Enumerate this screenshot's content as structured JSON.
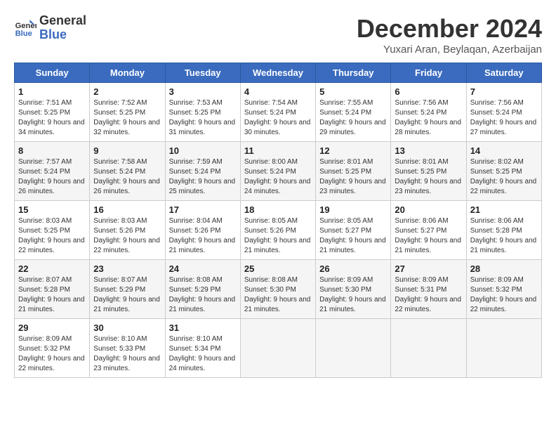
{
  "logo": {
    "line1": "General",
    "line2": "Blue"
  },
  "title": "December 2024",
  "subtitle": "Yuxari Aran, Beylaqan, Azerbaijan",
  "days_of_week": [
    "Sunday",
    "Monday",
    "Tuesday",
    "Wednesday",
    "Thursday",
    "Friday",
    "Saturday"
  ],
  "weeks": [
    [
      {
        "day": "1",
        "sunrise": "7:51 AM",
        "sunset": "5:25 PM",
        "daylight": "9 hours and 34 minutes."
      },
      {
        "day": "2",
        "sunrise": "7:52 AM",
        "sunset": "5:25 PM",
        "daylight": "9 hours and 32 minutes."
      },
      {
        "day": "3",
        "sunrise": "7:53 AM",
        "sunset": "5:25 PM",
        "daylight": "9 hours and 31 minutes."
      },
      {
        "day": "4",
        "sunrise": "7:54 AM",
        "sunset": "5:24 PM",
        "daylight": "9 hours and 30 minutes."
      },
      {
        "day": "5",
        "sunrise": "7:55 AM",
        "sunset": "5:24 PM",
        "daylight": "9 hours and 29 minutes."
      },
      {
        "day": "6",
        "sunrise": "7:56 AM",
        "sunset": "5:24 PM",
        "daylight": "9 hours and 28 minutes."
      },
      {
        "day": "7",
        "sunrise": "7:56 AM",
        "sunset": "5:24 PM",
        "daylight": "9 hours and 27 minutes."
      }
    ],
    [
      {
        "day": "8",
        "sunrise": "7:57 AM",
        "sunset": "5:24 PM",
        "daylight": "9 hours and 26 minutes."
      },
      {
        "day": "9",
        "sunrise": "7:58 AM",
        "sunset": "5:24 PM",
        "daylight": "9 hours and 26 minutes."
      },
      {
        "day": "10",
        "sunrise": "7:59 AM",
        "sunset": "5:24 PM",
        "daylight": "9 hours and 25 minutes."
      },
      {
        "day": "11",
        "sunrise": "8:00 AM",
        "sunset": "5:24 PM",
        "daylight": "9 hours and 24 minutes."
      },
      {
        "day": "12",
        "sunrise": "8:01 AM",
        "sunset": "5:25 PM",
        "daylight": "9 hours and 23 minutes."
      },
      {
        "day": "13",
        "sunrise": "8:01 AM",
        "sunset": "5:25 PM",
        "daylight": "9 hours and 23 minutes."
      },
      {
        "day": "14",
        "sunrise": "8:02 AM",
        "sunset": "5:25 PM",
        "daylight": "9 hours and 22 minutes."
      }
    ],
    [
      {
        "day": "15",
        "sunrise": "8:03 AM",
        "sunset": "5:25 PM",
        "daylight": "9 hours and 22 minutes."
      },
      {
        "day": "16",
        "sunrise": "8:03 AM",
        "sunset": "5:26 PM",
        "daylight": "9 hours and 22 minutes."
      },
      {
        "day": "17",
        "sunrise": "8:04 AM",
        "sunset": "5:26 PM",
        "daylight": "9 hours and 21 minutes."
      },
      {
        "day": "18",
        "sunrise": "8:05 AM",
        "sunset": "5:26 PM",
        "daylight": "9 hours and 21 minutes."
      },
      {
        "day": "19",
        "sunrise": "8:05 AM",
        "sunset": "5:27 PM",
        "daylight": "9 hours and 21 minutes."
      },
      {
        "day": "20",
        "sunrise": "8:06 AM",
        "sunset": "5:27 PM",
        "daylight": "9 hours and 21 minutes."
      },
      {
        "day": "21",
        "sunrise": "8:06 AM",
        "sunset": "5:28 PM",
        "daylight": "9 hours and 21 minutes."
      }
    ],
    [
      {
        "day": "22",
        "sunrise": "8:07 AM",
        "sunset": "5:28 PM",
        "daylight": "9 hours and 21 minutes."
      },
      {
        "day": "23",
        "sunrise": "8:07 AM",
        "sunset": "5:29 PM",
        "daylight": "9 hours and 21 minutes."
      },
      {
        "day": "24",
        "sunrise": "8:08 AM",
        "sunset": "5:29 PM",
        "daylight": "9 hours and 21 minutes."
      },
      {
        "day": "25",
        "sunrise": "8:08 AM",
        "sunset": "5:30 PM",
        "daylight": "9 hours and 21 minutes."
      },
      {
        "day": "26",
        "sunrise": "8:09 AM",
        "sunset": "5:30 PM",
        "daylight": "9 hours and 21 minutes."
      },
      {
        "day": "27",
        "sunrise": "8:09 AM",
        "sunset": "5:31 PM",
        "daylight": "9 hours and 22 minutes."
      },
      {
        "day": "28",
        "sunrise": "8:09 AM",
        "sunset": "5:32 PM",
        "daylight": "9 hours and 22 minutes."
      }
    ],
    [
      {
        "day": "29",
        "sunrise": "8:09 AM",
        "sunset": "5:32 PM",
        "daylight": "9 hours and 22 minutes."
      },
      {
        "day": "30",
        "sunrise": "8:10 AM",
        "sunset": "5:33 PM",
        "daylight": "9 hours and 23 minutes."
      },
      {
        "day": "31",
        "sunrise": "8:10 AM",
        "sunset": "5:34 PM",
        "daylight": "9 hours and 24 minutes."
      },
      null,
      null,
      null,
      null
    ]
  ],
  "labels": {
    "sunrise": "Sunrise:",
    "sunset": "Sunset:",
    "daylight": "Daylight:"
  }
}
